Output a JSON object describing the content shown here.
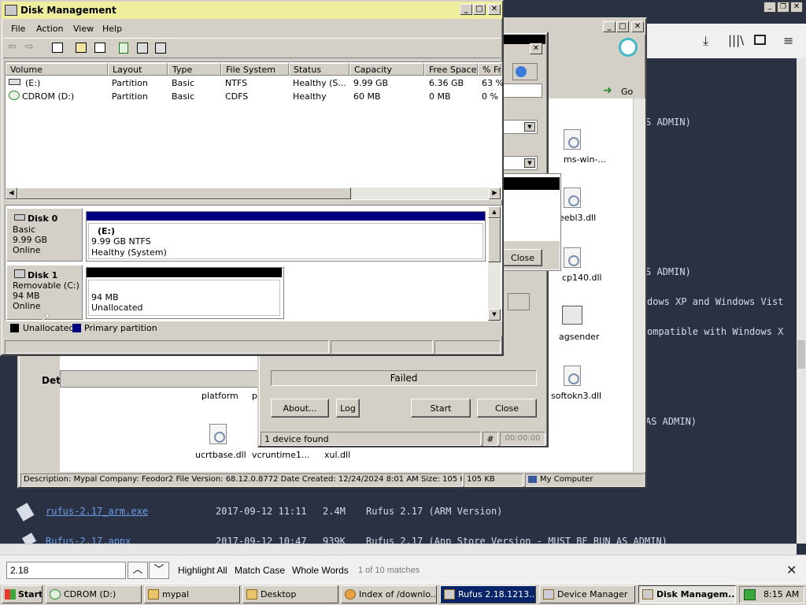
{
  "firefox": {
    "text_lines": [
      "S ADMIN)",
      "S ADMIN)",
      "dows XP and Windows Vist",
      "ompatible with Windows X",
      "AS ADMIN)"
    ],
    "files": [
      {
        "name": "rufus-2.17_arm.exe",
        "date": "2017-09-12 11:11",
        "size": "2.4M",
        "desc": "Rufus 2.17 (ARM Version)"
      },
      {
        "name": "Rufus-2.17.appx",
        "date": "2017-09-12 10:47",
        "size": "939K",
        "desc": "Rufus 2.17 (App Store Version - MUST BE RUN AS ADMIN)"
      }
    ]
  },
  "findbar": {
    "query": "2.18",
    "highlight_all": "Highlight All",
    "match_case": "Match Case",
    "whole_words": "Whole Words",
    "match_count": "1 of 10 matches"
  },
  "explorer": {
    "go_label": "Go",
    "det_label": "Det",
    "files": [
      "ms-win-...",
      "eebl3.dll",
      "cp140.dll",
      "agsender",
      "softokn3.dll",
      "platform",
      "pl",
      "ucrtbase.dll",
      "vcruntime1...",
      "xul.dll"
    ],
    "status_desc": "Description: Mypal Company: Feodor2 File Version: 68.12.0.8772 Date Created: 12/24/2024 8:01 AM Size: 105 KB",
    "status_size": "105 KB",
    "status_location": "My Computer"
  },
  "rufus": {
    "status": "Failed",
    "about": "About...",
    "log": "Log",
    "start": "Start",
    "close": "Close",
    "close2": "Close",
    "hash": "#",
    "devices": "1 device found",
    "timer": "00:00:00"
  },
  "diskmgmt": {
    "title": "Disk Management",
    "menu": [
      "File",
      "Action",
      "View",
      "Help"
    ],
    "columns": [
      "Volume",
      "Layout",
      "Type",
      "File System",
      "Status",
      "Capacity",
      "Free Space",
      "% Fr"
    ],
    "volumes": [
      [
        "(E:)",
        "Partition",
        "Basic",
        "NTFS",
        "Healthy (S...",
        "9.99 GB",
        "6.36 GB",
        "63 %"
      ],
      [
        "CDROM (D:)",
        "Partition",
        "Basic",
        "CDFS",
        "Healthy",
        "60 MB",
        "0 MB",
        "0 %"
      ]
    ],
    "disk0": {
      "name": "Disk 0",
      "type": "Basic",
      "size": "9.99 GB",
      "state": "Online",
      "part_label": "(E:)",
      "part_fs": "9.99 GB NTFS",
      "part_status": "Healthy (System)"
    },
    "disk1": {
      "name": "Disk 1",
      "type": "Removable (C:)",
      "size": "94 MB",
      "state": "Online",
      "part_size": "94 MB",
      "part_status": "Unallocated"
    },
    "legend": {
      "unallocated": "Unallocated",
      "primary": "Primary partition"
    }
  },
  "taskbar": {
    "start": "Start",
    "items": [
      "CDROM (D:)",
      "mypal",
      "Desktop",
      "Index of /downlo...",
      "Rufus 2.18.1213...",
      "Device Manager",
      "Disk Managem..."
    ],
    "clock": "8:15 AM"
  },
  "colors": {
    "primary_partition": "#000080",
    "unallocated": "#000000",
    "titlebar": "#eeee9e"
  }
}
